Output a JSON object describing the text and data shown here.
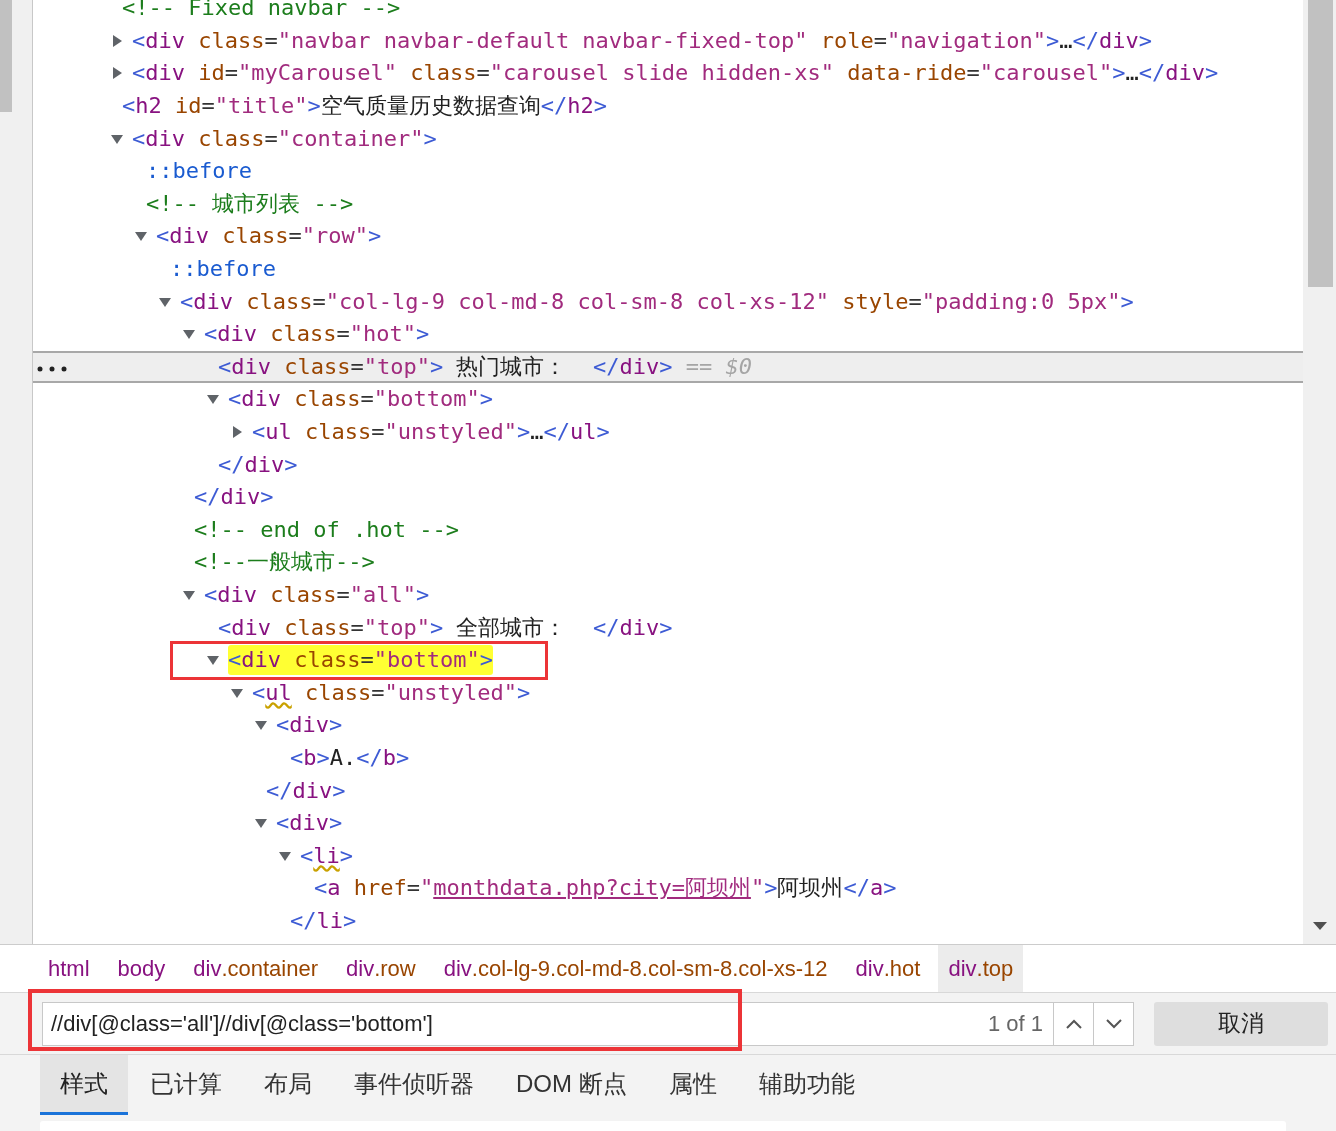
{
  "dom": [
    {
      "selected": false,
      "tokens": [
        {
          "kind": "comment",
          "text": "<!-- Fixed navbar -->"
        }
      ]
    },
    {
      "selected": false,
      "expanded": false,
      "tokens": [
        {
          "kind": "punct",
          "text": "<"
        },
        {
          "kind": "tag",
          "text": "div"
        },
        {
          "kind": "attr",
          "text": " class"
        },
        {
          "kind": "eq",
          "text": "="
        },
        {
          "kind": "value",
          "text": "\"navbar navbar-default navbar-fixed-top\""
        },
        {
          "kind": "attr",
          "text": " role"
        },
        {
          "kind": "eq",
          "text": "="
        },
        {
          "kind": "value",
          "text": "\"navigation\""
        },
        {
          "kind": "punct",
          "text": ">"
        },
        {
          "kind": "text",
          "text": "…"
        },
        {
          "kind": "punct",
          "text": "</"
        },
        {
          "kind": "tag",
          "text": "div"
        },
        {
          "kind": "punct",
          "text": ">"
        }
      ]
    },
    {
      "selected": false,
      "expanded": false,
      "tokens": [
        {
          "kind": "punct",
          "text": "<"
        },
        {
          "kind": "tag",
          "text": "div"
        },
        {
          "kind": "attr",
          "text": " id"
        },
        {
          "kind": "eq",
          "text": "="
        },
        {
          "kind": "value",
          "text": "\"myCarousel\""
        },
        {
          "kind": "attr",
          "text": " class"
        },
        {
          "kind": "eq",
          "text": "="
        },
        {
          "kind": "value",
          "text": "\"carousel slide hidden-xs\""
        },
        {
          "kind": "attr",
          "text": " data-ride"
        },
        {
          "kind": "eq",
          "text": "="
        },
        {
          "kind": "value",
          "text": "\"carousel\""
        },
        {
          "kind": "punct",
          "text": ">"
        },
        {
          "kind": "text",
          "text": "…"
        },
        {
          "kind": "punct",
          "text": "</"
        },
        {
          "kind": "tag",
          "text": "div"
        },
        {
          "kind": "punct",
          "text": ">"
        }
      ]
    },
    {
      "selected": false,
      "tokens": [
        {
          "kind": "punct",
          "text": "<"
        },
        {
          "kind": "tag",
          "text": "h2"
        },
        {
          "kind": "attr",
          "text": " id"
        },
        {
          "kind": "eq",
          "text": "="
        },
        {
          "kind": "value",
          "text": "\"title\""
        },
        {
          "kind": "punct",
          "text": ">"
        },
        {
          "kind": "text",
          "text": "空气质量历史数据查询"
        },
        {
          "kind": "punct",
          "text": "</"
        },
        {
          "kind": "tag",
          "text": "h2"
        },
        {
          "kind": "punct",
          "text": ">"
        }
      ]
    },
    {
      "selected": false,
      "expanded": true,
      "tokens": [
        {
          "kind": "punct",
          "text": "<"
        },
        {
          "kind": "tag",
          "text": "div"
        },
        {
          "kind": "attr",
          "text": " class"
        },
        {
          "kind": "eq",
          "text": "="
        },
        {
          "kind": "value",
          "text": "\"container\""
        },
        {
          "kind": "punct",
          "text": ">"
        }
      ],
      "children": [
        {
          "selected": false,
          "tokens": [
            {
              "kind": "pseudo",
              "text": "::before"
            }
          ]
        },
        {
          "selected": false,
          "tokens": [
            {
              "kind": "comment",
              "text": "<!-- 城市列表 -->"
            }
          ]
        },
        {
          "selected": false,
          "expanded": true,
          "tokens": [
            {
              "kind": "punct",
              "text": "<"
            },
            {
              "kind": "tag",
              "text": "div"
            },
            {
              "kind": "attr",
              "text": " class"
            },
            {
              "kind": "eq",
              "text": "="
            },
            {
              "kind": "value",
              "text": "\"row\""
            },
            {
              "kind": "punct",
              "text": ">"
            }
          ],
          "children": [
            {
              "selected": false,
              "tokens": [
                {
                  "kind": "pseudo",
                  "text": "::before"
                }
              ]
            },
            {
              "selected": false,
              "expanded": true,
              "tokens": [
                {
                  "kind": "punct",
                  "text": "<"
                },
                {
                  "kind": "tag",
                  "text": "div"
                },
                {
                  "kind": "attr",
                  "text": " class"
                },
                {
                  "kind": "eq",
                  "text": "="
                },
                {
                  "kind": "value",
                  "text": "\"col-lg-9 col-md-8 col-sm-8 col-xs-12\""
                },
                {
                  "kind": "attr",
                  "text": " style"
                },
                {
                  "kind": "eq",
                  "text": "="
                },
                {
                  "kind": "value",
                  "text": "\"padding:0 5px\""
                },
                {
                  "kind": "punct",
                  "text": ">"
                }
              ],
              "children": [
                {
                  "selected": false,
                  "expanded": true,
                  "tokens": [
                    {
                      "kind": "punct",
                      "text": "<"
                    },
                    {
                      "kind": "tag",
                      "text": "div"
                    },
                    {
                      "kind": "attr",
                      "text": " class"
                    },
                    {
                      "kind": "eq",
                      "text": "="
                    },
                    {
                      "kind": "value",
                      "text": "\"hot\""
                    },
                    {
                      "kind": "punct",
                      "text": ">"
                    }
                  ],
                  "closing": [
                    {
                      "kind": "punct",
                      "text": "</"
                    },
                    {
                      "kind": "tag",
                      "text": "div"
                    },
                    {
                      "kind": "punct",
                      "text": ">"
                    }
                  ],
                  "children": [
                    {
                      "selected": true,
                      "tokens": [
                        {
                          "kind": "punct",
                          "text": "<"
                        },
                        {
                          "kind": "tag",
                          "text": "div"
                        },
                        {
                          "kind": "attr",
                          "text": " class"
                        },
                        {
                          "kind": "eq",
                          "text": "="
                        },
                        {
                          "kind": "value",
                          "text": "\"top\""
                        },
                        {
                          "kind": "punct",
                          "text": ">"
                        },
                        {
                          "kind": "text",
                          "text": " 热门城市：  "
                        },
                        {
                          "kind": "punct",
                          "text": "</"
                        },
                        {
                          "kind": "tag",
                          "text": "div"
                        },
                        {
                          "kind": "punct",
                          "text": ">"
                        },
                        {
                          "kind": "hint",
                          "text": " == $0"
                        }
                      ]
                    },
                    {
                      "selected": false,
                      "expanded": true,
                      "tokens": [
                        {
                          "kind": "punct",
                          "text": "<"
                        },
                        {
                          "kind": "tag",
                          "text": "div"
                        },
                        {
                          "kind": "attr",
                          "text": " class"
                        },
                        {
                          "kind": "eq",
                          "text": "="
                        },
                        {
                          "kind": "value",
                          "text": "\"bottom\""
                        },
                        {
                          "kind": "punct",
                          "text": ">"
                        }
                      ],
                      "closing": [
                        {
                          "kind": "punct",
                          "text": "</"
                        },
                        {
                          "kind": "tag",
                          "text": "div"
                        },
                        {
                          "kind": "punct",
                          "text": ">"
                        }
                      ],
                      "children": [
                        {
                          "selected": false,
                          "expanded": false,
                          "tokens": [
                            {
                              "kind": "punct",
                              "text": "<"
                            },
                            {
                              "kind": "tag",
                              "text": "ul"
                            },
                            {
                              "kind": "attr",
                              "text": " class"
                            },
                            {
                              "kind": "eq",
                              "text": "="
                            },
                            {
                              "kind": "value",
                              "text": "\"unstyled\""
                            },
                            {
                              "kind": "punct",
                              "text": ">"
                            },
                            {
                              "kind": "text",
                              "text": "…"
                            },
                            {
                              "kind": "punct",
                              "text": "</"
                            },
                            {
                              "kind": "tag",
                              "text": "ul"
                            },
                            {
                              "kind": "punct",
                              "text": ">"
                            }
                          ]
                        }
                      ]
                    }
                  ]
                },
                {
                  "selected": false,
                  "tokens": [
                    {
                      "kind": "comment",
                      "text": "<!-- end of .hot -->"
                    }
                  ]
                },
                {
                  "selected": false,
                  "tokens": [
                    {
                      "kind": "comment",
                      "text": "<!--一般城市-->"
                    }
                  ]
                },
                {
                  "selected": false,
                  "expanded": true,
                  "tokens": [
                    {
                      "kind": "punct",
                      "text": "<"
                    },
                    {
                      "kind": "tag",
                      "text": "div"
                    },
                    {
                      "kind": "attr",
                      "text": " class"
                    },
                    {
                      "kind": "eq",
                      "text": "="
                    },
                    {
                      "kind": "value",
                      "text": "\"all\""
                    },
                    {
                      "kind": "punct",
                      "text": ">"
                    }
                  ],
                  "children": [
                    {
                      "selected": false,
                      "tokens": [
                        {
                          "kind": "punct",
                          "text": "<"
                        },
                        {
                          "kind": "tag",
                          "text": "div"
                        },
                        {
                          "kind": "attr",
                          "text": " class"
                        },
                        {
                          "kind": "eq",
                          "text": "="
                        },
                        {
                          "kind": "value",
                          "text": "\"top\""
                        },
                        {
                          "kind": "punct",
                          "text": ">"
                        },
                        {
                          "kind": "text",
                          "text": " 全部城市：  "
                        },
                        {
                          "kind": "punct",
                          "text": "</"
                        },
                        {
                          "kind": "tag",
                          "text": "div"
                        },
                        {
                          "kind": "punct",
                          "text": ">"
                        }
                      ]
                    },
                    {
                      "selected": false,
                      "search_match": true,
                      "annotated": true,
                      "expanded": true,
                      "tokens": [
                        {
                          "kind": "punct",
                          "text": "<"
                        },
                        {
                          "kind": "tag",
                          "text": "div"
                        },
                        {
                          "kind": "attr",
                          "text": " class"
                        },
                        {
                          "kind": "eq",
                          "text": "="
                        },
                        {
                          "kind": "value",
                          "text": "\"bottom\""
                        },
                        {
                          "kind": "punct",
                          "text": ">"
                        }
                      ],
                      "children": [
                        {
                          "selected": false,
                          "expanded": true,
                          "tokens": [
                            {
                              "kind": "punct",
                              "text": "<"
                            },
                            {
                              "kind": "tag",
                              "text": "ul",
                              "squiggle": true
                            },
                            {
                              "kind": "attr",
                              "text": " class"
                            },
                            {
                              "kind": "eq",
                              "text": "="
                            },
                            {
                              "kind": "value",
                              "text": "\"unstyled\""
                            },
                            {
                              "kind": "punct",
                              "text": ">"
                            }
                          ],
                          "children": [
                            {
                              "selected": false,
                              "expanded": true,
                              "tokens": [
                                {
                                  "kind": "punct",
                                  "text": "<"
                                },
                                {
                                  "kind": "tag",
                                  "text": "div"
                                },
                                {
                                  "kind": "punct",
                                  "text": ">"
                                }
                              ],
                              "closing": [
                                {
                                  "kind": "punct",
                                  "text": "</"
                                },
                                {
                                  "kind": "tag",
                                  "text": "div"
                                },
                                {
                                  "kind": "punct",
                                  "text": ">"
                                }
                              ],
                              "children": [
                                {
                                  "selected": false,
                                  "tokens": [
                                    {
                                      "kind": "punct",
                                      "text": "<"
                                    },
                                    {
                                      "kind": "tag",
                                      "text": "b"
                                    },
                                    {
                                      "kind": "punct",
                                      "text": ">"
                                    },
                                    {
                                      "kind": "text",
                                      "text": "A."
                                    },
                                    {
                                      "kind": "punct",
                                      "text": "</"
                                    },
                                    {
                                      "kind": "tag",
                                      "text": "b"
                                    },
                                    {
                                      "kind": "punct",
                                      "text": ">"
                                    }
                                  ]
                                }
                              ]
                            },
                            {
                              "selected": false,
                              "expanded": true,
                              "tokens": [
                                {
                                  "kind": "punct",
                                  "text": "<"
                                },
                                {
                                  "kind": "tag",
                                  "text": "div"
                                },
                                {
                                  "kind": "punct",
                                  "text": ">"
                                }
                              ],
                              "children": [
                                {
                                  "selected": false,
                                  "expanded": true,
                                  "tokens": [
                                    {
                                      "kind": "punct",
                                      "text": "<"
                                    },
                                    {
                                      "kind": "tag",
                                      "text": "li",
                                      "squiggle": true
                                    },
                                    {
                                      "kind": "punct",
                                      "text": ">"
                                    }
                                  ],
                                  "closing": [
                                    {
                                      "kind": "punct",
                                      "text": "</"
                                    },
                                    {
                                      "kind": "tag",
                                      "text": "li"
                                    },
                                    {
                                      "kind": "punct",
                                      "text": ">"
                                    }
                                  ],
                                  "children": [
                                    {
                                      "selected": false,
                                      "tokens": [
                                        {
                                          "kind": "punct",
                                          "text": "<"
                                        },
                                        {
                                          "kind": "tag",
                                          "text": "a"
                                        },
                                        {
                                          "kind": "attr",
                                          "text": " href"
                                        },
                                        {
                                          "kind": "eq",
                                          "text": "="
                                        },
                                        {
                                          "kind": "value",
                                          "text": "\""
                                        },
                                        {
                                          "kind": "link",
                                          "text": "monthdata.php?city=阿坝州"
                                        },
                                        {
                                          "kind": "value",
                                          "text": "\""
                                        },
                                        {
                                          "kind": "punct",
                                          "text": ">"
                                        },
                                        {
                                          "kind": "text",
                                          "text": "阿坝州"
                                        },
                                        {
                                          "kind": "punct",
                                          "text": "</"
                                        },
                                        {
                                          "kind": "tag",
                                          "text": "a"
                                        },
                                        {
                                          "kind": "punct",
                                          "text": ">"
                                        }
                                      ]
                                    }
                                  ]
                                }
                              ]
                            }
                          ]
                        }
                      ]
                    }
                  ]
                }
              ]
            }
          ]
        }
      ]
    }
  ],
  "breadcrumbs": [
    {
      "tag": "html",
      "selected": false
    },
    {
      "tag": "body",
      "selected": false
    },
    {
      "tag": "div",
      "class_part": ".container",
      "selected": false
    },
    {
      "tag": "div",
      "class_part": ".row",
      "selected": false
    },
    {
      "tag": "div",
      "class_part": ".col-lg-9.col-md-8.col-sm-8.col-xs-12",
      "selected": false
    },
    {
      "tag": "div",
      "class_part": ".hot",
      "selected": false
    },
    {
      "tag": "div",
      "class_part": ".top",
      "selected": true
    }
  ],
  "search": {
    "value": "//div[@class='all']//div[@class='bottom']",
    "count": "1 of 1",
    "cancel": "取消",
    "annotated": true
  },
  "tabs": [
    {
      "label": "样式",
      "selected": true
    },
    {
      "label": "已计算",
      "selected": false
    },
    {
      "label": "布局",
      "selected": false
    },
    {
      "label": "事件侦听器",
      "selected": false
    },
    {
      "label": "DOM 断点",
      "selected": false
    },
    {
      "label": "属性",
      "selected": false
    },
    {
      "label": "辅助功能",
      "selected": false
    }
  ]
}
